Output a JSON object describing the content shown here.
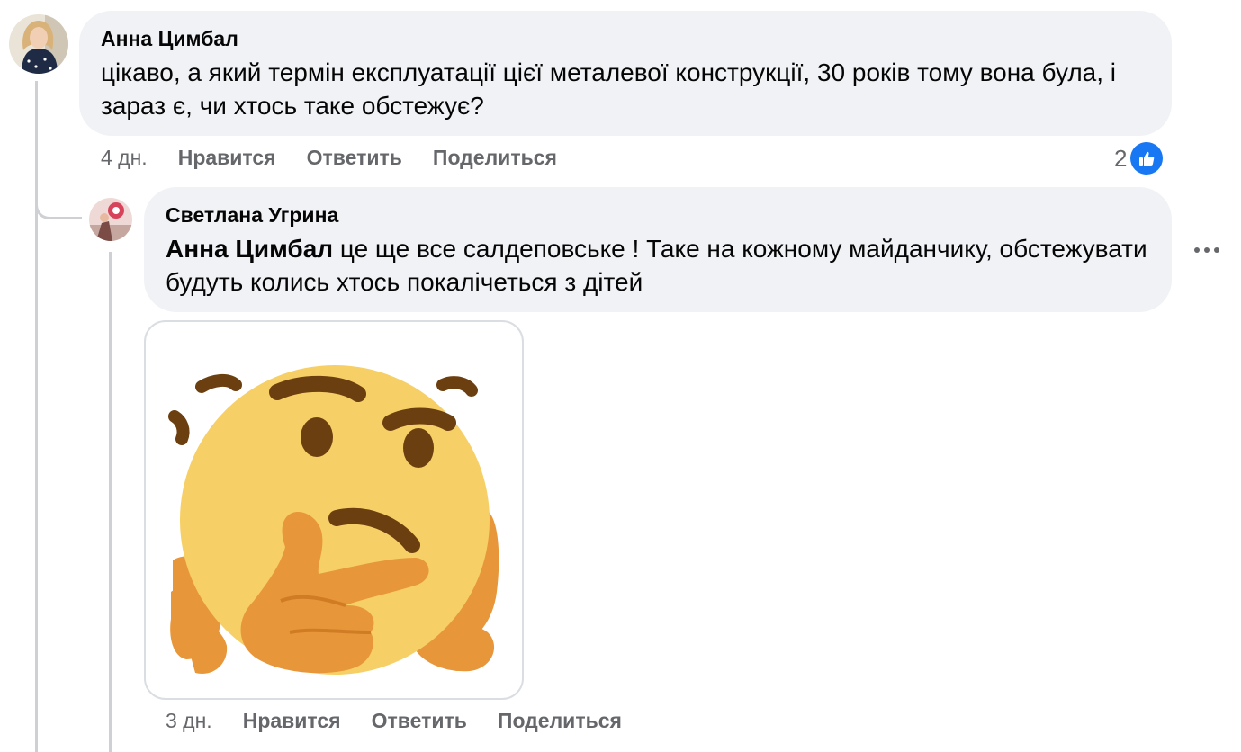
{
  "comments": [
    {
      "author": "Анна Цимбал",
      "text": "цікаво, а який термін експлуатації цієї металевої конструкції, 30 років тому вона була, і зараз є, чи хтось таке обстежує?",
      "time": "4 дн.",
      "like_label": "Нравится",
      "reply_label": "Ответить",
      "share_label": "Поделиться",
      "reaction_count": "2",
      "reaction_icon": "like-icon"
    }
  ],
  "reply": {
    "author": "Светлана Угрина",
    "mention": "Анна Цимбал",
    "text": " це ще все салдеповське ! Таке на кожному майданчику, обстежувати будуть колись хтось покалічеться з дітей",
    "time": "3 дн.",
    "like_label": "Нравится",
    "reply_label": "Ответить",
    "share_label": "Поделиться",
    "sticker": "thinking-face-emoji",
    "more_icon": "more-horizontal-icon"
  },
  "colors": {
    "bubble": "#f0f2f5",
    "like_blue": "#1877f2",
    "secondary_text": "#65676b",
    "thread_line": "#ced0d4",
    "emoji_yellow": "#f6cf66",
    "emoji_hand": "#e8963a",
    "emoji_brown": "#6b3f10"
  }
}
